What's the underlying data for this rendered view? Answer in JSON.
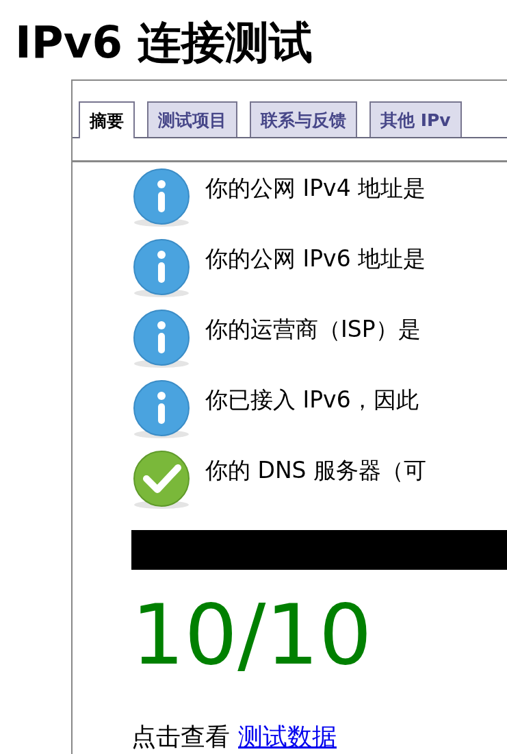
{
  "title": "IPv6 连接测试",
  "tabs": [
    {
      "label": "摘要",
      "selected": true
    },
    {
      "label": "测试项目",
      "selected": false
    },
    {
      "label": "联系与反馈",
      "selected": false
    },
    {
      "label": "其他 IPv",
      "selected": false
    }
  ],
  "results": [
    {
      "kind": "info",
      "text": "你的公网 IPv4 地址是"
    },
    {
      "kind": "info",
      "text": "你的公网 IPv6 地址是"
    },
    {
      "kind": "info",
      "text": "你的运营商（ISP）是"
    },
    {
      "kind": "info",
      "text": "你已接入 IPv6，因此"
    },
    {
      "kind": "ok",
      "text": "你的 DNS 服务器（可"
    }
  ],
  "score": "10/10",
  "footer": {
    "text": "点击查看",
    "link": "测试数据"
  }
}
